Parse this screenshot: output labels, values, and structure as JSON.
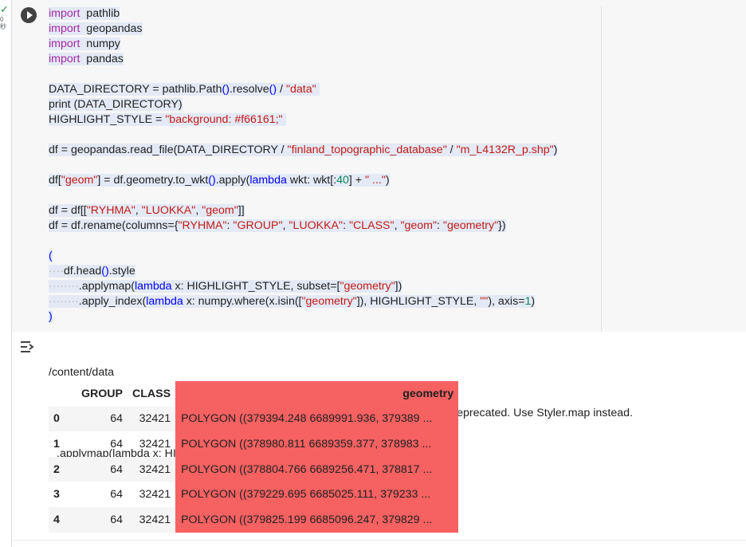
{
  "cell_status": {
    "check": "✓",
    "time": "0 秒"
  },
  "code_lines": [
    {
      "parts": [
        [
          "kw",
          "import"
        ],
        [
          "",
          "  pathlib"
        ]
      ]
    },
    {
      "parts": [
        [
          "kw",
          "import"
        ],
        [
          "",
          "  geopandas"
        ]
      ]
    },
    {
      "parts": [
        [
          "kw",
          "import"
        ],
        [
          "",
          "  numpy"
        ]
      ]
    },
    {
      "parts": [
        [
          "kw",
          "import"
        ],
        [
          "",
          "  pandas"
        ]
      ]
    },
    {
      "parts": []
    },
    {
      "parts": [
        [
          "",
          "DATA_DIRECTORY = pathlib.Path"
        ],
        [
          "kb",
          "()"
        ],
        [
          "",
          ".resolve"
        ],
        [
          "kb",
          "()"
        ],
        [
          "",
          " / "
        ],
        [
          "st",
          "\"data\""
        ],
        [
          "",
          " "
        ]
      ]
    },
    {
      "parts": [
        [
          "",
          "print (DATA_DIRECTORY)"
        ]
      ]
    },
    {
      "parts": [
        [
          "",
          "HIGHLIGHT_STYLE = "
        ],
        [
          "st",
          "\"background: #f66161;\""
        ],
        [
          "",
          " "
        ]
      ]
    },
    {
      "parts": []
    },
    {
      "parts": [
        [
          "",
          "df = geopandas.read_file(DATA_DIRECTORY / "
        ],
        [
          "st",
          "\"finland_topographic_database\""
        ],
        [
          "",
          " / "
        ],
        [
          "st",
          "\"m_L4132R_p.shp\""
        ],
        [
          "",
          ")"
        ]
      ]
    },
    {
      "parts": []
    },
    {
      "parts": [
        [
          "",
          "df["
        ],
        [
          "st",
          "\"geom\""
        ],
        [
          "",
          "] = df.geometry.to_wkt"
        ],
        [
          "kb",
          "()"
        ],
        [
          "",
          ".apply("
        ],
        [
          "kb",
          "lambda"
        ],
        [
          "",
          " wkt: wkt[:"
        ],
        [
          "pn",
          "40"
        ],
        [
          "",
          "] + "
        ],
        [
          "st",
          "\" ...\""
        ],
        [
          "",
          ")"
        ]
      ]
    },
    {
      "parts": []
    },
    {
      "parts": [
        [
          "",
          "df = df[["
        ],
        [
          "st",
          "\"RYHMA\""
        ],
        [
          "",
          ", "
        ],
        [
          "st",
          "\"LUOKKA\""
        ],
        [
          "",
          ", "
        ],
        [
          "st",
          "\"geom\""
        ],
        [
          "",
          "]]"
        ]
      ]
    },
    {
      "parts": [
        [
          "",
          "df = df.rename(columns={"
        ],
        [
          "st",
          "\"RYHMA\""
        ],
        [
          "",
          ": "
        ],
        [
          "st",
          "\"GROUP\""
        ],
        [
          "",
          ", "
        ],
        [
          "st",
          "\"LUOKKA\""
        ],
        [
          "",
          ": "
        ],
        [
          "st",
          "\"CLASS\""
        ],
        [
          "",
          ", "
        ],
        [
          "st",
          "\"geom\""
        ],
        [
          "",
          ": "
        ],
        [
          "st",
          "\"geometry\""
        ],
        [
          "",
          "})"
        ]
      ]
    },
    {
      "parts": []
    },
    {
      "parts": [
        [
          "kb",
          "("
        ]
      ]
    },
    {
      "parts": [
        [
          "dots",
          "····"
        ],
        [
          "",
          "df.head"
        ],
        [
          "kb",
          "()"
        ],
        [
          "",
          ".style"
        ]
      ]
    },
    {
      "parts": [
        [
          "dots",
          "········"
        ],
        [
          "",
          ".applymap("
        ],
        [
          "kb",
          "lambda"
        ],
        [
          "",
          " x: HIGHLIGHT_STYLE, subset=["
        ],
        [
          "st",
          "\"geometry\""
        ],
        [
          "",
          "])"
        ]
      ]
    },
    {
      "parts": [
        [
          "dots",
          "········"
        ],
        [
          "",
          ".apply_index("
        ],
        [
          "kb",
          "lambda"
        ],
        [
          "",
          " x: numpy.where(x.isin(["
        ],
        [
          "st",
          "\"geometry\""
        ],
        [
          "",
          "]), HIGHLIGHT_STYLE, "
        ],
        [
          "st",
          "\"\""
        ],
        [
          "",
          "), axis="
        ],
        [
          "pn",
          "1"
        ],
        [
          "",
          ")"
        ]
      ]
    },
    {
      "parts": [
        [
          "kb",
          ")"
        ]
      ]
    }
  ],
  "output": {
    "line1": "/content/data",
    "line2": "<ipython-input-3-3b46c523c9a9>:19: FutureWarning: Styler.applymap has been deprecated. Use Styler.map instead.",
    "line3": ".applymap(lambda x: HIGHLIGHT_STYLE, subset=[\"geometry\"])"
  },
  "table": {
    "columns": [
      "GROUP",
      "CLASS",
      "geometry"
    ],
    "rows": [
      {
        "index": "0",
        "group": "64",
        "class": "32421",
        "geometry": "POLYGON ((379394.248 6689991.936, 379389 ..."
      },
      {
        "index": "1",
        "group": "64",
        "class": "32421",
        "geometry": "POLYGON ((378980.811 6689359.377, 378983 ..."
      },
      {
        "index": "2",
        "group": "64",
        "class": "32421",
        "geometry": "POLYGON ((378804.766 6689256.471, 378817 ..."
      },
      {
        "index": "3",
        "group": "64",
        "class": "32421",
        "geometry": "POLYGON ((379229.695 6685025.111, 379233 ..."
      },
      {
        "index": "4",
        "group": "64",
        "class": "32421",
        "geometry": "POLYGON ((379825.199 6685096.247, 379829 ..."
      }
    ]
  },
  "colors": {
    "highlight": "#f66161",
    "keyword": "#a626a4",
    "string": "#c41a16",
    "builtin": "#0000ff",
    "number": "#098658"
  },
  "icons": {
    "run": "play-icon",
    "output": "output-collapse-icon",
    "status": "check-icon"
  }
}
